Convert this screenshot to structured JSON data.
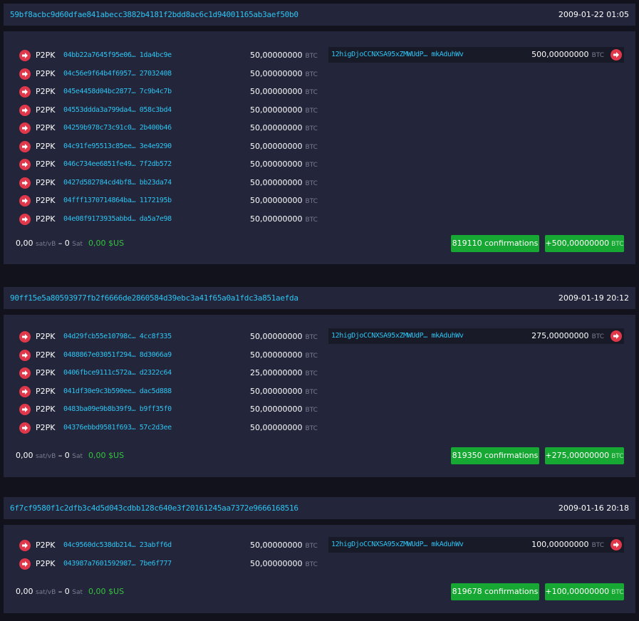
{
  "ui": {
    "colors": {
      "accent_link": "#2ec4f2",
      "arrow": "#e0384a",
      "button_green": "#16a832",
      "panel": "#23253a",
      "background": "#11121c"
    },
    "arrow_icon": "arrow-right-circle-icon"
  },
  "transactions": [
    {
      "txid": "59bf8acbc9d60dfae841abecc3882b4181f2bdd8ac6c1d94001165ab3aef50b0",
      "time": "2009-01-22 01:05",
      "inputs": [
        {
          "type": "P2PK",
          "address": "04bb22a7645f95e06… 1da4bc9e",
          "amount": "50,00000000",
          "unit": "BTC"
        },
        {
          "type": "P2PK",
          "address": "04c56e9f64b4f6957… 27032408",
          "amount": "50,00000000",
          "unit": "BTC"
        },
        {
          "type": "P2PK",
          "address": "045e4458d04bc2877… 7c9b4c7b",
          "amount": "50,00000000",
          "unit": "BTC"
        },
        {
          "type": "P2PK",
          "address": "04553ddda3a799da4… 058c3bd4",
          "amount": "50,00000000",
          "unit": "BTC"
        },
        {
          "type": "P2PK",
          "address": "04259b978c73c91c0… 2b400b46",
          "amount": "50,00000000",
          "unit": "BTC"
        },
        {
          "type": "P2PK",
          "address": "04c91fe95513c85ee… 3e4e9290",
          "amount": "50,00000000",
          "unit": "BTC"
        },
        {
          "type": "P2PK",
          "address": "046c734ee6851fe49… 7f2db572",
          "amount": "50,00000000",
          "unit": "BTC"
        },
        {
          "type": "P2PK",
          "address": "0427d582784cd4bf8… bb23da74",
          "amount": "50,00000000",
          "unit": "BTC"
        },
        {
          "type": "P2PK",
          "address": "04fff1370714864ba… 1172195b",
          "amount": "50,00000000",
          "unit": "BTC"
        },
        {
          "type": "P2PK",
          "address": "04e08f9173935abbd… da5a7e98",
          "amount": "50,00000000",
          "unit": "BTC"
        }
      ],
      "output": {
        "address": "12higDjoCCNXSA95xZMWUdP… mkAduhWv",
        "amount": "500,00000000",
        "unit": "BTC"
      },
      "fee": {
        "rate": "0,00",
        "rate_unit": "sat/vB",
        "dash": "–",
        "sat": "0",
        "sat_unit": "Sat",
        "usd": "0,00 $US"
      },
      "confirmations": "819110 confirmations",
      "total": {
        "amount": "+500,00000000",
        "unit": "BTC"
      }
    },
    {
      "txid": "90ff15e5a80593977fb2f6666de2860584d39ebc3a41f65a0a1fdc3a851aefda",
      "time": "2009-01-19 20:12",
      "inputs": [
        {
          "type": "P2PK",
          "address": "04d29fcb55e10798c… 4cc8f335",
          "amount": "50,00000000",
          "unit": "BTC"
        },
        {
          "type": "P2PK",
          "address": "0488867e03051f294… 8d3066a9",
          "amount": "50,00000000",
          "unit": "BTC"
        },
        {
          "type": "P2PK",
          "address": "0406fbce9111c572a… d2322c64",
          "amount": "25,00000000",
          "unit": "BTC"
        },
        {
          "type": "P2PK",
          "address": "041df30e9c3b590ee… dac5d888",
          "amount": "50,00000000",
          "unit": "BTC"
        },
        {
          "type": "P2PK",
          "address": "0483ba09e9b8b39f9… b9ff35f0",
          "amount": "50,00000000",
          "unit": "BTC"
        },
        {
          "type": "P2PK",
          "address": "04376ebbd9581f693… 57c2d3ee",
          "amount": "50,00000000",
          "unit": "BTC"
        }
      ],
      "output": {
        "address": "12higDjoCCNXSA95xZMWUdP… mkAduhWv",
        "amount": "275,00000000",
        "unit": "BTC"
      },
      "fee": {
        "rate": "0,00",
        "rate_unit": "sat/vB",
        "dash": "–",
        "sat": "0",
        "sat_unit": "Sat",
        "usd": "0,00 $US"
      },
      "confirmations": "819350 confirmations",
      "total": {
        "amount": "+275,00000000",
        "unit": "BTC"
      }
    },
    {
      "txid": "6f7cf9580f1c2dfb3c4d5d043cdbb128c640e3f20161245aa7372e9666168516",
      "time": "2009-01-16 20:18",
      "inputs": [
        {
          "type": "P2PK",
          "address": "04c9560dc538db214… 23abff6d",
          "amount": "50,00000000",
          "unit": "BTC"
        },
        {
          "type": "P2PK",
          "address": "043987a7601592987… 7be6f777",
          "amount": "50,00000000",
          "unit": "BTC"
        }
      ],
      "output": {
        "address": "12higDjoCCNXSA95xZMWUdP… mkAduhWv",
        "amount": "100,00000000",
        "unit": "BTC"
      },
      "fee": {
        "rate": "0,00",
        "rate_unit": "sat/vB",
        "dash": "–",
        "sat": "0",
        "sat_unit": "Sat",
        "usd": "0,00 $US"
      },
      "confirmations": "819678 confirmations",
      "total": {
        "amount": "+100,00000000",
        "unit": "BTC"
      }
    }
  ]
}
